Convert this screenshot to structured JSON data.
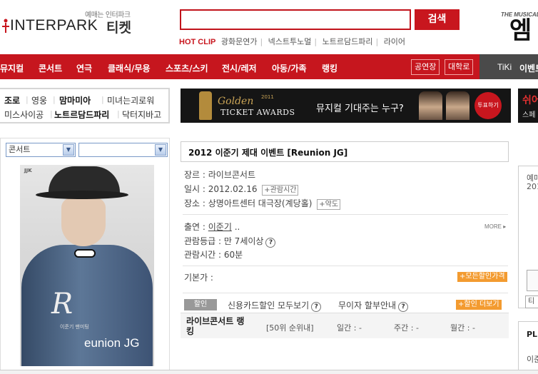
{
  "header": {
    "tagline": "예매는 인터파크",
    "logo_text": "INTERPARK",
    "logo_ticket": "티켓",
    "search_button": "검색",
    "hotclip_label": "HOT CLIP",
    "hotclip_links": [
      "광화문연가",
      "넥스트투노멀",
      "노트르담드파리",
      "라이어"
    ],
    "brand_small": "THE MUSICAL",
    "brand_big": "엠"
  },
  "nav": {
    "items": [
      "뮤지컬",
      "콘서트",
      "연극",
      "클래식/무용",
      "스포츠/스키",
      "전시/레저",
      "아동/가족",
      "랭킹"
    ],
    "boxes": [
      "공연장",
      "대학로"
    ],
    "tiki": "TiKi",
    "event": "이벤트"
  },
  "keywords": {
    "row1": [
      "조로",
      "영웅",
      "맘마미아",
      "미녀는괴로워"
    ],
    "row2": [
      "미스사이공",
      "노트르담드파리",
      "닥터지바고"
    ]
  },
  "banner": {
    "golden": "Golden",
    "year": "2011",
    "ticket_awards": "TICKET AWARDS",
    "question": "뮤지컬 기대주는 누구?",
    "vote": "투표하기",
    "side_a": "쉬어",
    "side_b": "스페"
  },
  "filters": {
    "genre": "콘서트",
    "sub": ""
  },
  "poster": {
    "logo": "JJK",
    "signature": "R",
    "title": "eunion JG",
    "subtitle": "이준기 팬미팅"
  },
  "detail": {
    "title": "2012 이준기 제대 이벤트 [Reunion JG]",
    "genre": "장르 : 라이브콘서트",
    "date": "일시 : 2012.02.16",
    "date_tag": "+관람시간",
    "venue": "장소 : 상명아트센터 대극장(계당홀)",
    "venue_tag": "+약도",
    "cast_label": "출연 : ",
    "cast_value": "이준기",
    "cast_more": " ..",
    "age": "관람등급 : 만 7세이상",
    "runtime": "관람시간 : 60분",
    "more": "MORE",
    "price_label": "기본가 :",
    "all_discount": "+모든할인가격",
    "discount_label": "할인",
    "card_discount": "신용카드할인 모두보기",
    "installment": "무이자 할부안내",
    "more_discount": "+할인 더보기"
  },
  "ranking": {
    "title": "라이브콘서트 랭킹",
    "cells": [
      "[50위 순위내]",
      "일간 : -",
      "주간 : -",
      "월간 : -"
    ]
  },
  "right": {
    "box1_a": "예매",
    "box1_b": "201",
    "tab": "티",
    "box2_a": "PL",
    "box2_b": "이준"
  }
}
